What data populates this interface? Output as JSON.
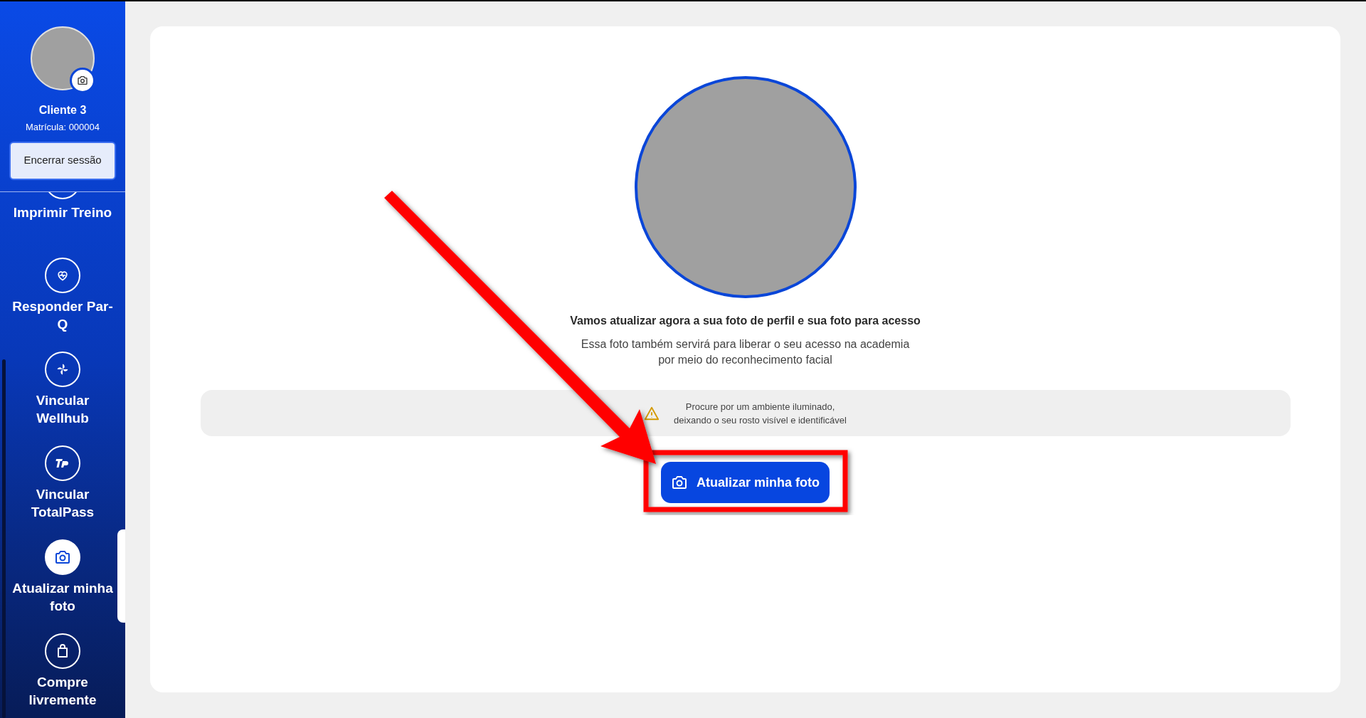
{
  "profile": {
    "name": "Cliente 3",
    "registration": "Matrícula: 000004",
    "logout_button": "Encerrar sessão"
  },
  "menu": [
    {
      "label": "Imprimir Treino",
      "selected": false
    },
    {
      "label": "Responder Par-Q",
      "selected": false
    },
    {
      "label": "Vincular Wellhub",
      "selected": false
    },
    {
      "label": "Vincular TotalPass",
      "selected": false
    },
    {
      "label": "Atualizar minha foto",
      "selected": true
    },
    {
      "label": "Compre livremente",
      "selected": false
    }
  ],
  "main": {
    "title": "Vamos atualizar agora a sua foto de perfil e sua foto para acesso",
    "subtitle_lines": [
      "Essa foto também servirá para liberar o seu acesso na academia",
      "por meio do reconhecimento facial"
    ],
    "tip_lines": [
      "Procure por um ambiente iluminado,",
      "deixando o seu rosto visível e identificável"
    ],
    "button": "Atualizar minha foto"
  }
}
